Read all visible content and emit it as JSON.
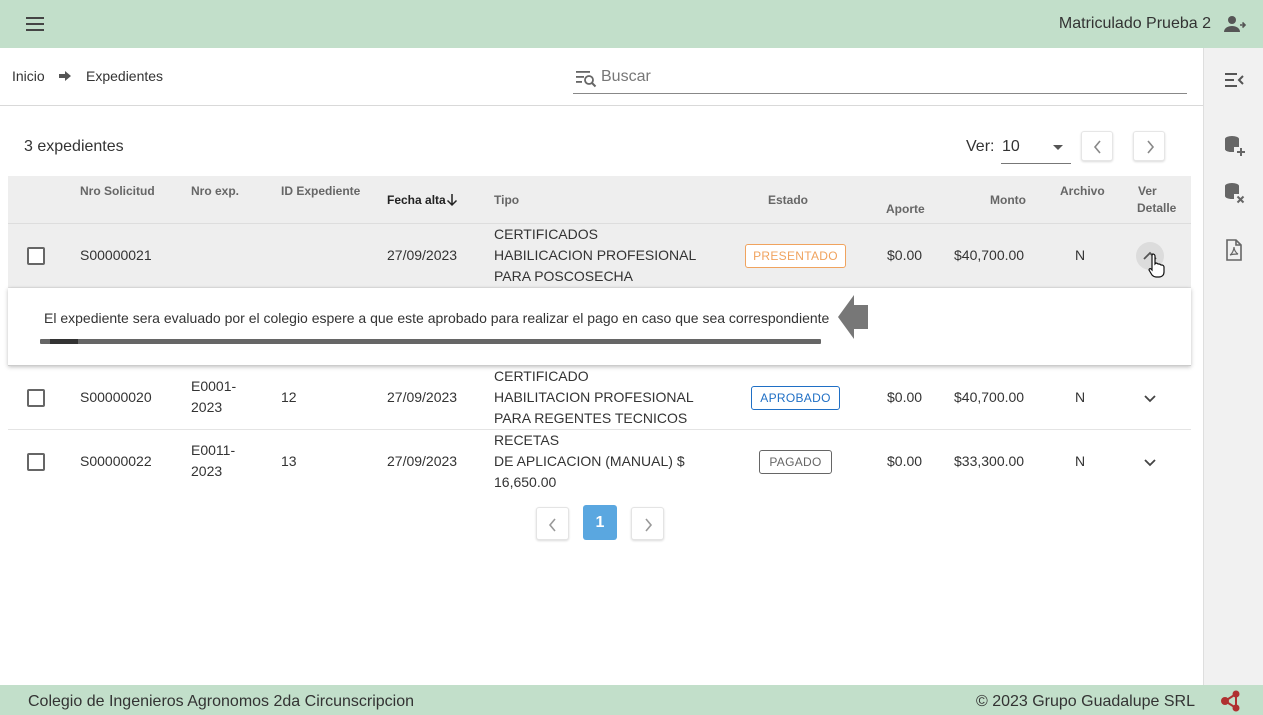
{
  "header": {
    "menu_icon": "hamburger-menu-icon",
    "user_name": "Matriculado Prueba 2",
    "user_icon": "account-switch-icon"
  },
  "breadcrumb": {
    "home": "Inicio",
    "separator_icon": "arrow-right-icon",
    "current": "Expedientes"
  },
  "search": {
    "placeholder": "Buscar",
    "value": "",
    "icon": "filter-search-icon"
  },
  "sidebar": {
    "items": [
      {
        "icon": "menu-collapse-icon"
      },
      {
        "icon": "database-plus-icon"
      },
      {
        "icon": "database-remove-icon"
      },
      {
        "icon": "file-pdf-icon"
      }
    ]
  },
  "summary": {
    "count_text": "3 expedientes",
    "ver_label": "Ver:",
    "ver_value": "10"
  },
  "table": {
    "headers": {
      "nro_solicitud": "Nro Solicitud",
      "nro_exp": "Nro exp.",
      "id_expediente": "ID Expediente",
      "fecha_alta": "Fecha alta",
      "tipo": "Tipo",
      "estado": "Estado",
      "aporte": "Aporte",
      "monto": "Monto",
      "archivo": "Archivo",
      "ver_detalle_1": "Ver",
      "ver_detalle_2": "Detalle"
    },
    "rows": [
      {
        "nro_solicitud": "S00000021",
        "nro_exp_1": "",
        "nro_exp_2": "",
        "id_expediente": "",
        "fecha_alta": "27/09/2023",
        "tipo_1": "CERTIFICADOS",
        "tipo_2": "HABILICACION PROFESIONAL",
        "tipo_3": "PARA POSCOSECHA",
        "estado": "PRESENTADO",
        "aporte": "$0.00",
        "monto": "$40,700.00",
        "archivo": "N"
      },
      {
        "nro_solicitud": "S00000020",
        "nro_exp_1": "E0001-",
        "nro_exp_2": "2023",
        "id_expediente": "12",
        "fecha_alta": "27/09/2023",
        "tipo_1": "CERTIFICADO",
        "tipo_2": "HABILITACION PROFESIONAL",
        "tipo_3": "PARA REGENTES TECNICOS",
        "estado": "APROBADO",
        "aporte": "$0.00",
        "monto": "$40,700.00",
        "archivo": "N"
      },
      {
        "nro_solicitud": "S00000022",
        "nro_exp_1": "E0011-",
        "nro_exp_2": "2023",
        "id_expediente": "13",
        "fecha_alta": "27/09/2023",
        "tipo_1": "RECETAS",
        "tipo_2": "DE APLICACION (MANUAL) $",
        "tipo_3": "16,650.00",
        "estado": "PAGADO",
        "aporte": "$0.00",
        "monto": "$33,300.00",
        "archivo": "N"
      }
    ],
    "detail_message": "El expediente sera evaluado por el colegio espere a que este aprobado para realizar el pago en caso que sea correspondiente"
  },
  "pagination": {
    "current_page": "1"
  },
  "footer": {
    "left": "Colegio de Ingenieros Agronomos 2da Circunscripcion",
    "right": "© 2023 Grupo Guadalupe SRL",
    "logo_icon": "share-logo-icon"
  },
  "colors": {
    "header_bg": "#c2dfca",
    "presentado": "#f0a35e",
    "aprobado": "#1f6fc5",
    "pagado": "#666666",
    "active_page": "#5aa7e0"
  }
}
